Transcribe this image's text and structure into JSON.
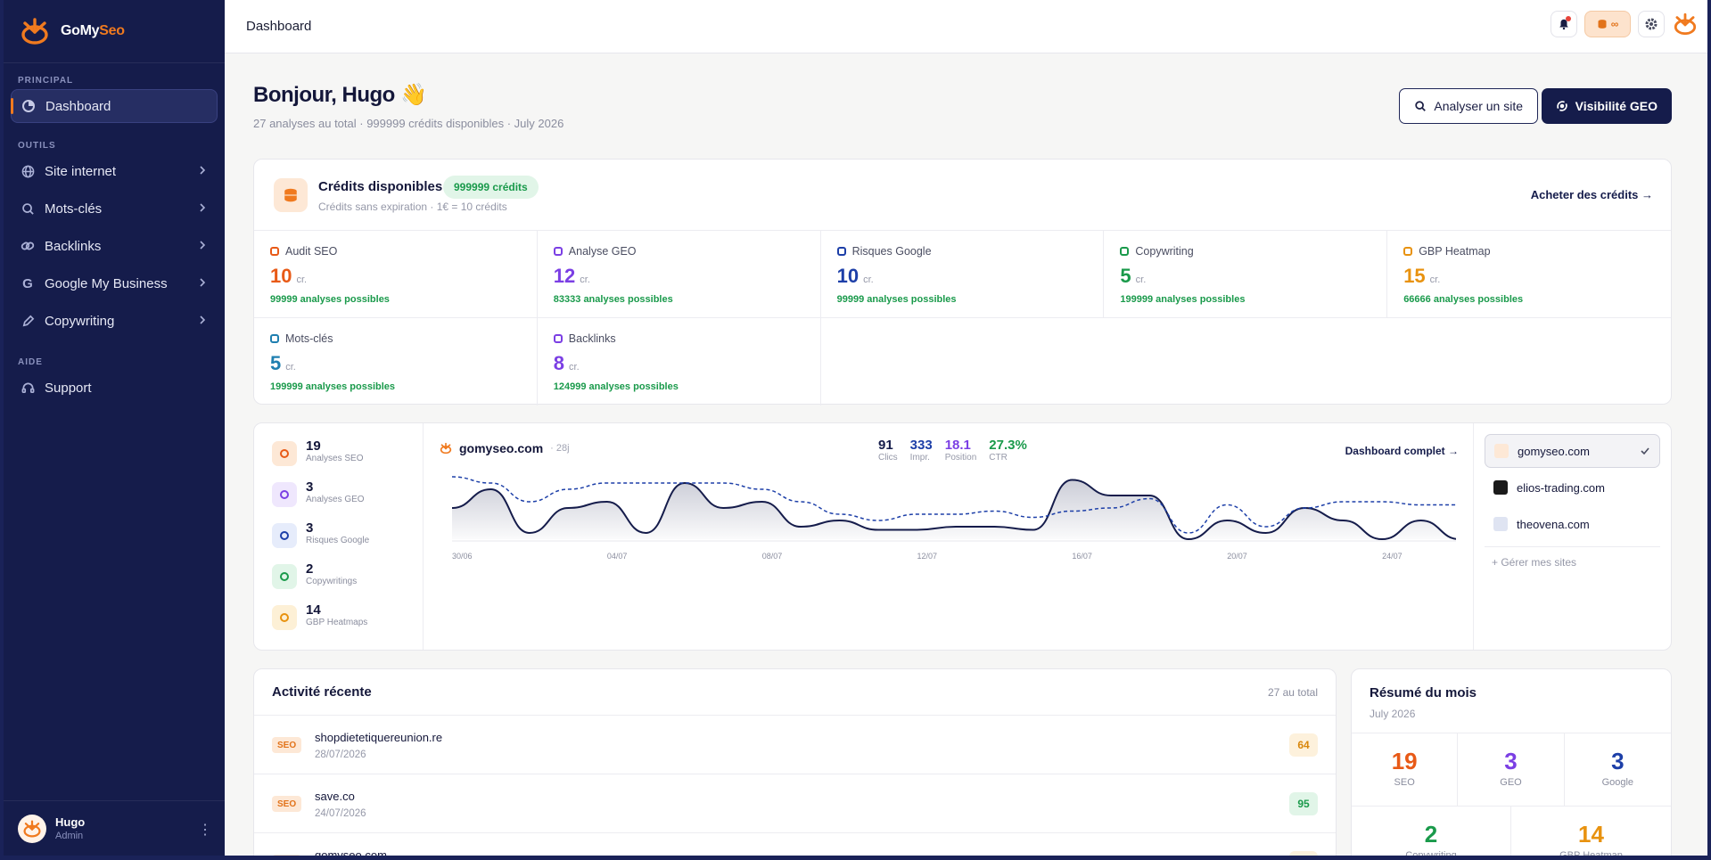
{
  "brand": {
    "name_main": "GoMy",
    "name_accent": "Seo"
  },
  "colors": {
    "sidebar": "#151c4b",
    "accent": "#f07a1f",
    "green": "#1a9a4b",
    "purple": "#7b3fe4",
    "blue": "#1d3fa8",
    "amber": "#e8920f"
  },
  "sidebar": {
    "sections": {
      "principal": "PRINCIPAL",
      "outils": "OUTILS",
      "aide": "AIDE"
    },
    "dashboard": "Dashboard",
    "items": [
      {
        "label": "Site internet",
        "icon": "globe-icon"
      },
      {
        "label": "Mots-clés",
        "icon": "search-icon"
      },
      {
        "label": "Backlinks",
        "icon": "link-icon"
      },
      {
        "label": "Google My Business",
        "icon": "google-icon"
      },
      {
        "label": "Copywriting",
        "icon": "pen-icon"
      }
    ],
    "support": "Support"
  },
  "user": {
    "name": "Hugo",
    "role": "Admin"
  },
  "topbar": {
    "title": "Dashboard",
    "credits_symbol": "∞"
  },
  "greeting": {
    "title": "Bonjour, Hugo 👋",
    "subtitle": "27 analyses au total · 999999 crédits disponibles · July 2026"
  },
  "actions": {
    "analyze": "Analyser un site",
    "geo": "Visibilité GEO"
  },
  "credits": {
    "title": "Crédits disponibles",
    "badge": "999999 crédits",
    "subtitle": "Crédits sans expiration · 1€ = 10 crédits",
    "buy_link": "Acheter des crédits →",
    "unit": "cr.",
    "tools": [
      {
        "name": "Audit SEO",
        "value": "10",
        "possible": "99999 analyses possibles",
        "color": "#e85a17"
      },
      {
        "name": "Analyse GEO",
        "value": "12",
        "possible": "83333 analyses possibles",
        "color": "#7b3fe4"
      },
      {
        "name": "Risques Google",
        "value": "10",
        "possible": "99999 analyses possibles",
        "color": "#1d3fa8"
      },
      {
        "name": "Copywriting",
        "value": "5",
        "possible": "199999 analyses possibles",
        "color": "#1a9a4b"
      },
      {
        "name": "GBP Heatmap",
        "value": "15",
        "possible": "66666 analyses possibles",
        "color": "#e8920f"
      },
      {
        "name": "Mots-clés",
        "value": "5",
        "possible": "199999 analyses possibles",
        "color": "#1f7fb0"
      },
      {
        "name": "Backlinks",
        "value": "8",
        "possible": "124999 analyses possibles",
        "color": "#7b3fe4"
      }
    ]
  },
  "summary_counts": [
    {
      "num": "19",
      "label": "Analyses SEO",
      "color": "#e85a17",
      "bg": "#fde8d6",
      "icon": "search-icon"
    },
    {
      "num": "3",
      "label": "Analyses GEO",
      "color": "#7b3fe4",
      "bg": "#efe7fd",
      "icon": "orbit-icon"
    },
    {
      "num": "3",
      "label": "Risques Google",
      "color": "#1d3fa8",
      "bg": "#e6ecfb",
      "icon": "google-icon"
    },
    {
      "num": "2",
      "label": "Copywritings",
      "color": "#1a9a4b",
      "bg": "#e1f5e8",
      "icon": "pen-icon"
    },
    {
      "num": "14",
      "label": "GBP Heatmaps",
      "color": "#e8920f",
      "bg": "#fdf0d6",
      "icon": "heatmap-icon"
    }
  ],
  "perf": {
    "site": "gomyseo.com",
    "period": "· 28j",
    "link": "Dashboard complet →",
    "stats": [
      {
        "value": "91",
        "label": "Clics",
        "color": "#151c4b"
      },
      {
        "value": "333",
        "label": "Impr.",
        "color": "#1d3fa8"
      },
      {
        "value": "18.1",
        "label": "Position",
        "color": "#7b3fe4"
      },
      {
        "value": "27.3%",
        "label": "CTR",
        "color": "#1a9a4b"
      }
    ]
  },
  "chart_data": {
    "type": "line",
    "x": [
      "30/06",
      "01/07",
      "02/07",
      "03/07",
      "04/07",
      "05/07",
      "06/07",
      "07/07",
      "08/07",
      "09/07",
      "10/07",
      "11/07",
      "12/07",
      "13/07",
      "14/07",
      "15/07",
      "16/07",
      "17/07",
      "18/07",
      "19/07",
      "20/07",
      "21/07",
      "22/07",
      "23/07",
      "24/07",
      "25/07"
    ],
    "tick_labels": [
      "30/06",
      "04/07",
      "08/07",
      "12/07",
      "16/07",
      "20/07",
      "24/07"
    ],
    "series": [
      {
        "style": "solid-filled",
        "color": "#151c4b",
        "values": [
          5,
          8,
          1,
          5,
          6,
          1,
          9,
          5,
          6,
          2,
          3,
          1.5,
          1.5,
          2,
          2,
          1.5,
          9.5,
          7,
          7,
          0,
          3,
          1,
          5,
          3,
          0,
          3,
          0
        ]
      },
      {
        "style": "dashed",
        "color": "#1d3fa8",
        "values": [
          10,
          9,
          6,
          8,
          9,
          9,
          9,
          9,
          8,
          6,
          4,
          3,
          4,
          4,
          4.5,
          3.5,
          4.5,
          5,
          6.5,
          1,
          5.5,
          2,
          5,
          6,
          6,
          5.5,
          5.5
        ]
      }
    ],
    "ylim": [
      0,
      10
    ],
    "grid": false,
    "legend": "none"
  },
  "sites": {
    "list": [
      {
        "name": "gomyseo.com",
        "selected": true
      },
      {
        "name": "elios-trading.com",
        "selected": false
      },
      {
        "name": "theovena.com",
        "selected": false
      }
    ],
    "manage": "+ Gérer mes sites"
  },
  "activity": {
    "title": "Activité récente",
    "count": "27 au total",
    "rows": [
      {
        "badge": "SEO",
        "site": "shopdietetiquereunion.re",
        "date": "28/07/2026",
        "score": "64",
        "score_color": "#d9870c",
        "score_bg": "#fdf1dc"
      },
      {
        "badge": "SEO",
        "site": "save.co",
        "date": "24/07/2026",
        "score": "95",
        "score_color": "#1a9a4b",
        "score_bg": "#e1f5e8"
      },
      {
        "badge": "SEO",
        "site": "gomyseo.com",
        "date": "",
        "score": "",
        "score_color": "#d9870c",
        "score_bg": "#fdf1dc"
      }
    ]
  },
  "resume": {
    "title": "Résumé du mois",
    "month": "July 2026",
    "row1": [
      {
        "num": "19",
        "label": "SEO",
        "color": "#e85a17"
      },
      {
        "num": "3",
        "label": "GEO",
        "color": "#7b3fe4"
      },
      {
        "num": "3",
        "label": "Google",
        "color": "#1d3fa8"
      }
    ],
    "row2": [
      {
        "num": "2",
        "label": "Copywriting",
        "color": "#1a9a4b"
      },
      {
        "num": "14",
        "label": "GBP Heatmap",
        "color": "#e8920f"
      }
    ]
  }
}
